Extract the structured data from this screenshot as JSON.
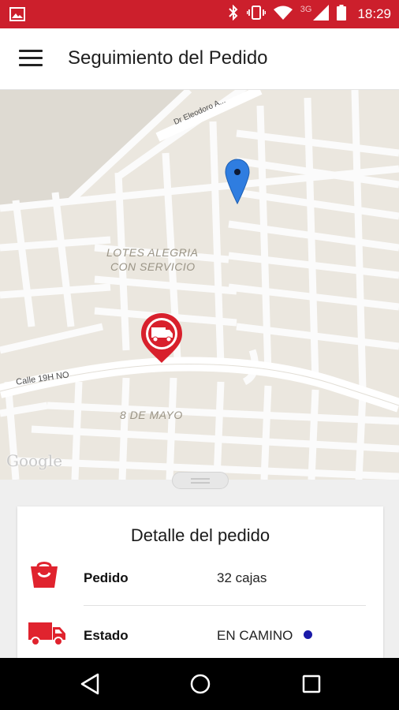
{
  "status_bar": {
    "time": "18:29",
    "network": "3G",
    "icons": [
      "image-icon",
      "bluetooth-icon",
      "vibrate-icon",
      "wifi-icon",
      "signal-icon",
      "battery-icon"
    ],
    "background": "#cc1f2c"
  },
  "app_bar": {
    "title": "Seguimiento del Pedido",
    "menu_icon": "hamburger-menu-icon"
  },
  "map": {
    "labels": {
      "area_1_line1": "LOTES ALEGRIA",
      "area_1_line2": "CON SERVICIO",
      "area_2": "8 DE MAYO",
      "street_1": "Calle 19H NO",
      "street_2": "Dr Eleodoro A..."
    },
    "attribution": "Google",
    "markers": [
      "location-pin-icon",
      "delivery-truck-marker-icon"
    ],
    "colors": {
      "pin": "#2f7de0",
      "truck_marker": "#d8202c"
    }
  },
  "detail": {
    "title": "Detalle del pedido",
    "rows": [
      {
        "label": "Pedido",
        "value": "32 cajas",
        "icon": "shopping-bag-icon"
      },
      {
        "label": "Estado",
        "value": "EN CAMINO",
        "icon": "truck-icon"
      }
    ],
    "accent": "#e0232e"
  },
  "nav_bar": {
    "buttons": [
      "back-icon",
      "home-icon",
      "recents-icon"
    ]
  }
}
